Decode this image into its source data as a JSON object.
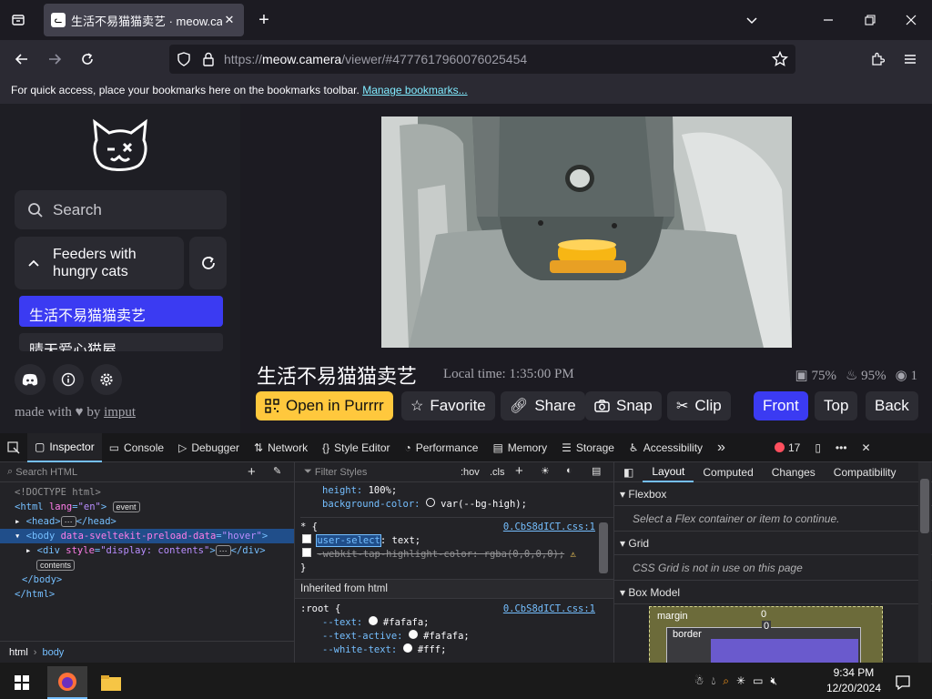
{
  "browser": {
    "tab_title": "生活不易猫猫卖艺 · meow.camera",
    "url_scheme": "https://",
    "url_host": "meow.camera",
    "url_path": "/viewer/#4777617960076025454",
    "bookmarks_text": "For quick access, place your bookmarks here on the bookmarks toolbar.",
    "bookmarks_link": "Manage bookmarks..."
  },
  "sidebar": {
    "search_placeholder": "Search",
    "group_label_line1": "Feeders with",
    "group_label_line2": "hungry cats",
    "feeders": [
      "生活不易猫猫卖艺",
      "晴天爱心猫屋"
    ],
    "made_with": "made with",
    "by": "by",
    "author": "imput"
  },
  "viewer": {
    "feeder_name": "生活不易猫猫卖艺",
    "local_time": "Local time: 1:35:00 PM",
    "stat_food": "75%",
    "stat_battery": "95%",
    "stat_viewers": "1"
  },
  "actions": {
    "open": "Open in Purrrr",
    "favorite": "Favorite",
    "share": "Share",
    "snap": "Snap",
    "clip": "Clip",
    "front": "Front",
    "top": "Top",
    "back": "Back"
  },
  "colors": {
    "accent_blue": "#3b3bf2",
    "accent_yellow": "#ffc83d",
    "devtools_link": "#75bfff"
  },
  "devtools": {
    "tabs": [
      "Inspector",
      "Console",
      "Debugger",
      "Network",
      "Style Editor",
      "Performance",
      "Memory",
      "Storage",
      "Accessibility"
    ],
    "error_count": "17",
    "search_html": "Search HTML",
    "filter_styles": "Filter Styles",
    "hov": ":hov",
    "cls": ".cls",
    "tree": {
      "doctype": "<!DOCTYPE html>",
      "html_open_tag": "html",
      "html_attr": "lang",
      "html_val": "\"en\"",
      "event_badge": "event",
      "head": "<head>",
      "head_close": "</head>",
      "body_tag": "body",
      "body_attr": "data-sveltekit-preload-data",
      "body_val": "\"hover\"",
      "div_tag": "div",
      "div_attr": "style",
      "div_val": "\"display: contents\"",
      "div_close": "</div>",
      "contents_badge": "contents",
      "body_close": "</body>",
      "html_close": "</html>"
    },
    "breadcrumb": [
      "html",
      "body"
    ],
    "css": {
      "height_prop": "height:",
      "height_val": "100%;",
      "bg_prop": "background-color:",
      "bg_val": "var(--bg-high);",
      "star_selector": "* ",
      "source": "0.CbS8dICT.css:1",
      "user_select_prop": "user-select",
      "user_select_val": ": text;",
      "tap_prop": "-webkit-tap-highlight-color: rgba(0,0,0,0);",
      "inherited": "Inherited from html",
      "root_selector": ":root ",
      "text_prop": "--text:",
      "text_val": "#fafafa;",
      "text_active_prop": "--text-active:",
      "text_active_val": "#fafafa;",
      "white_text_prop": "--white-text:",
      "white_text_val": "#fff;"
    },
    "layout_tabs": [
      "Layout",
      "Computed",
      "Changes",
      "Compatibility"
    ],
    "flexbox": "Flexbox",
    "flexbox_msg": "Select a Flex container or item to continue.",
    "grid": "Grid",
    "grid_msg": "CSS Grid is not in use on this page",
    "box_model": "Box Model",
    "margin_label": "margin",
    "border_label": "border",
    "zero": "0"
  },
  "taskbar": {
    "time": "9:34 PM",
    "date": "12/20/2024"
  }
}
